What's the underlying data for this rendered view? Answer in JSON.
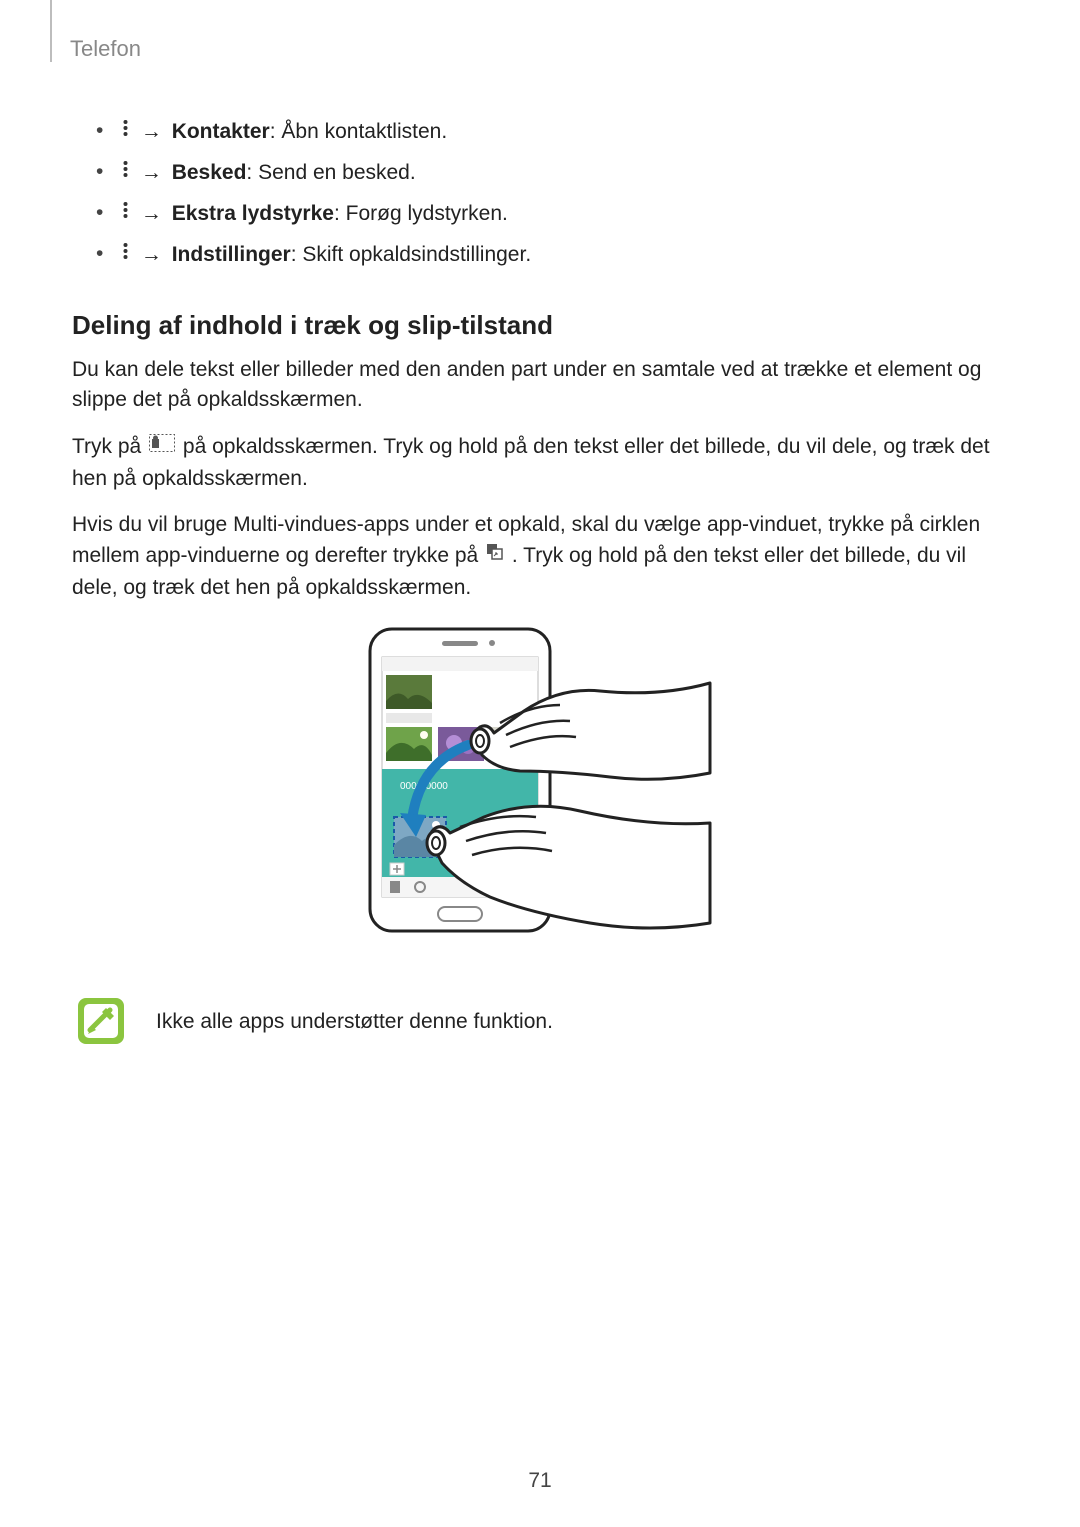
{
  "header": {
    "section": "Telefon"
  },
  "options": [
    {
      "label": "Kontakter",
      "desc": ": Åbn kontaktlisten."
    },
    {
      "label": "Besked",
      "desc": ": Send en besked."
    },
    {
      "label": "Ekstra lydstyrke",
      "desc": ": Forøg lydstyrken."
    },
    {
      "label": "Indstillinger",
      "desc": ": Skift opkaldsindstillinger."
    }
  ],
  "arrow": "→",
  "subheading": "Deling af indhold i træk og slip-tilstand",
  "para1": "Du kan dele tekst eller billeder med den anden part under en samtale ved at trække et element og slippe det på opkaldsskærmen.",
  "para2_a": "Tryk på ",
  "para2_b": " på opkaldsskærmen. Tryk og hold på den tekst eller det billede, du vil dele, og træk det hen på opkaldsskærmen.",
  "para3_a": "Hvis du vil bruge Multi-vindues-apps under et opkald, skal du vælge app-vinduet, trykke på cirklen mellem app-vinduerne og derefter trykke på ",
  "para3_b": ". Tryk og hold på den tekst eller det billede, du vil dele, og træk det hen på opkaldsskærmen.",
  "illustration_label": "0000-0000",
  "note": "Ikke alle apps understøtter denne funktion.",
  "page": "71"
}
